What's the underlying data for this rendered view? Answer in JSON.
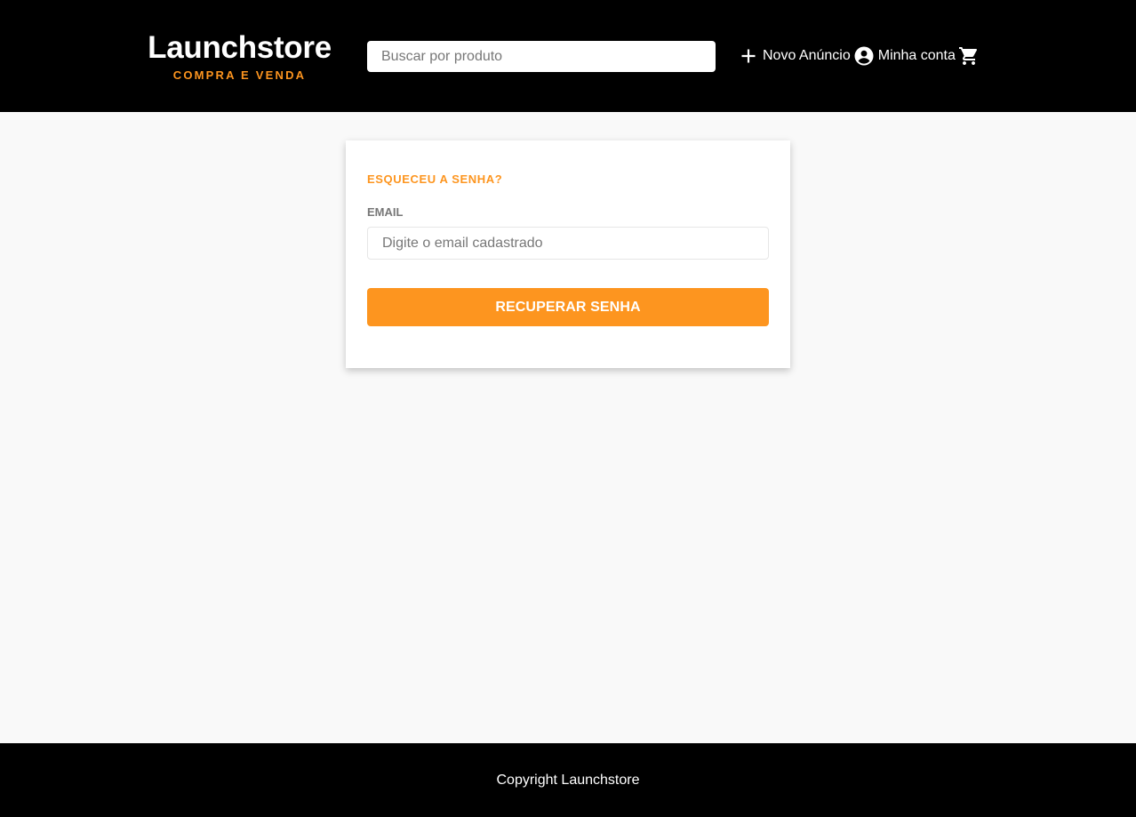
{
  "colors": {
    "header_bg": "#000000",
    "accent": "#fd951f",
    "page_bg": "#f9f9f9",
    "label_gray": "#777777"
  },
  "header": {
    "logo": {
      "title": "Launchstore",
      "subtitle": "COMPRA E VENDA"
    },
    "search": {
      "placeholder": "Buscar por produto",
      "value": ""
    },
    "nav": {
      "new_ad": {
        "label": "Novo Anúncio",
        "icon": "plus-icon"
      },
      "account": {
        "label": "Minha conta",
        "icon": "account-circle-icon"
      },
      "cart": {
        "icon": "cart-icon"
      }
    }
  },
  "form": {
    "title": "ESQUECEU A SENHA?",
    "email_label": "EMAIL",
    "email_placeholder": "Digite o email cadastrado",
    "email_value": "",
    "submit_label": "RECUPERAR SENHA"
  },
  "footer": {
    "copyright": "Copyright Launchstore"
  }
}
